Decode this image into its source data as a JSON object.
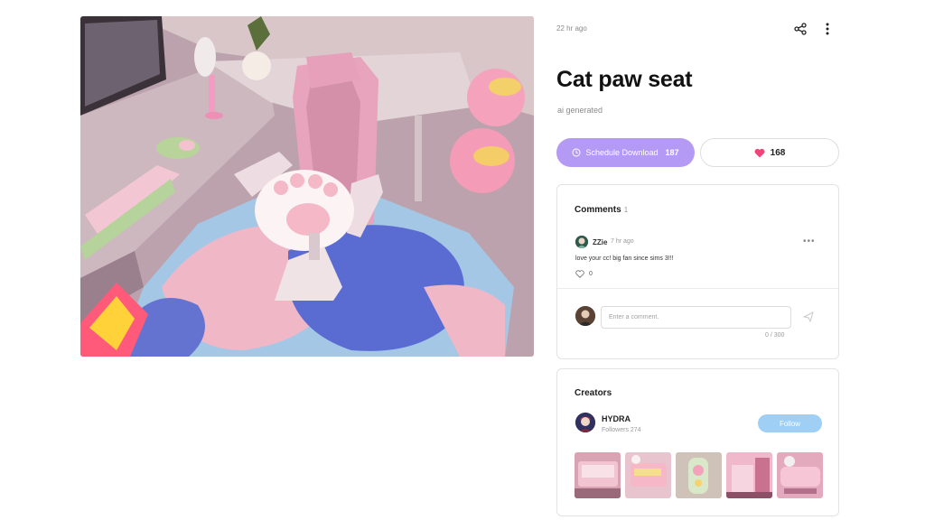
{
  "post": {
    "time": "22 hr ago",
    "title": "Cat paw seat",
    "subtitle": "ai generated"
  },
  "actions": {
    "schedule_label": "Schedule Download",
    "schedule_count": "187",
    "likes": "168"
  },
  "comments": {
    "title": "Comments",
    "count": "1",
    "items": [
      {
        "user": "ZZie",
        "time": "7 hr ago",
        "text": "love your cc! big fan since sims 3!!!",
        "likes": "0"
      }
    ],
    "input_placeholder": "Enter a comment.",
    "char_count": "0 / 300"
  },
  "creators": {
    "title": "Creators",
    "name": "HYDRA",
    "followers": "Followers 274",
    "follow_label": "Follow"
  },
  "icons": {
    "share": "share-icon",
    "more": "more-vertical-icon",
    "clock": "clock-icon",
    "heart": "heart-icon",
    "send": "send-icon"
  },
  "colors": {
    "schedule_button": "#b49af5",
    "heart": "#f0457a",
    "follow_button": "#9fcff5"
  }
}
